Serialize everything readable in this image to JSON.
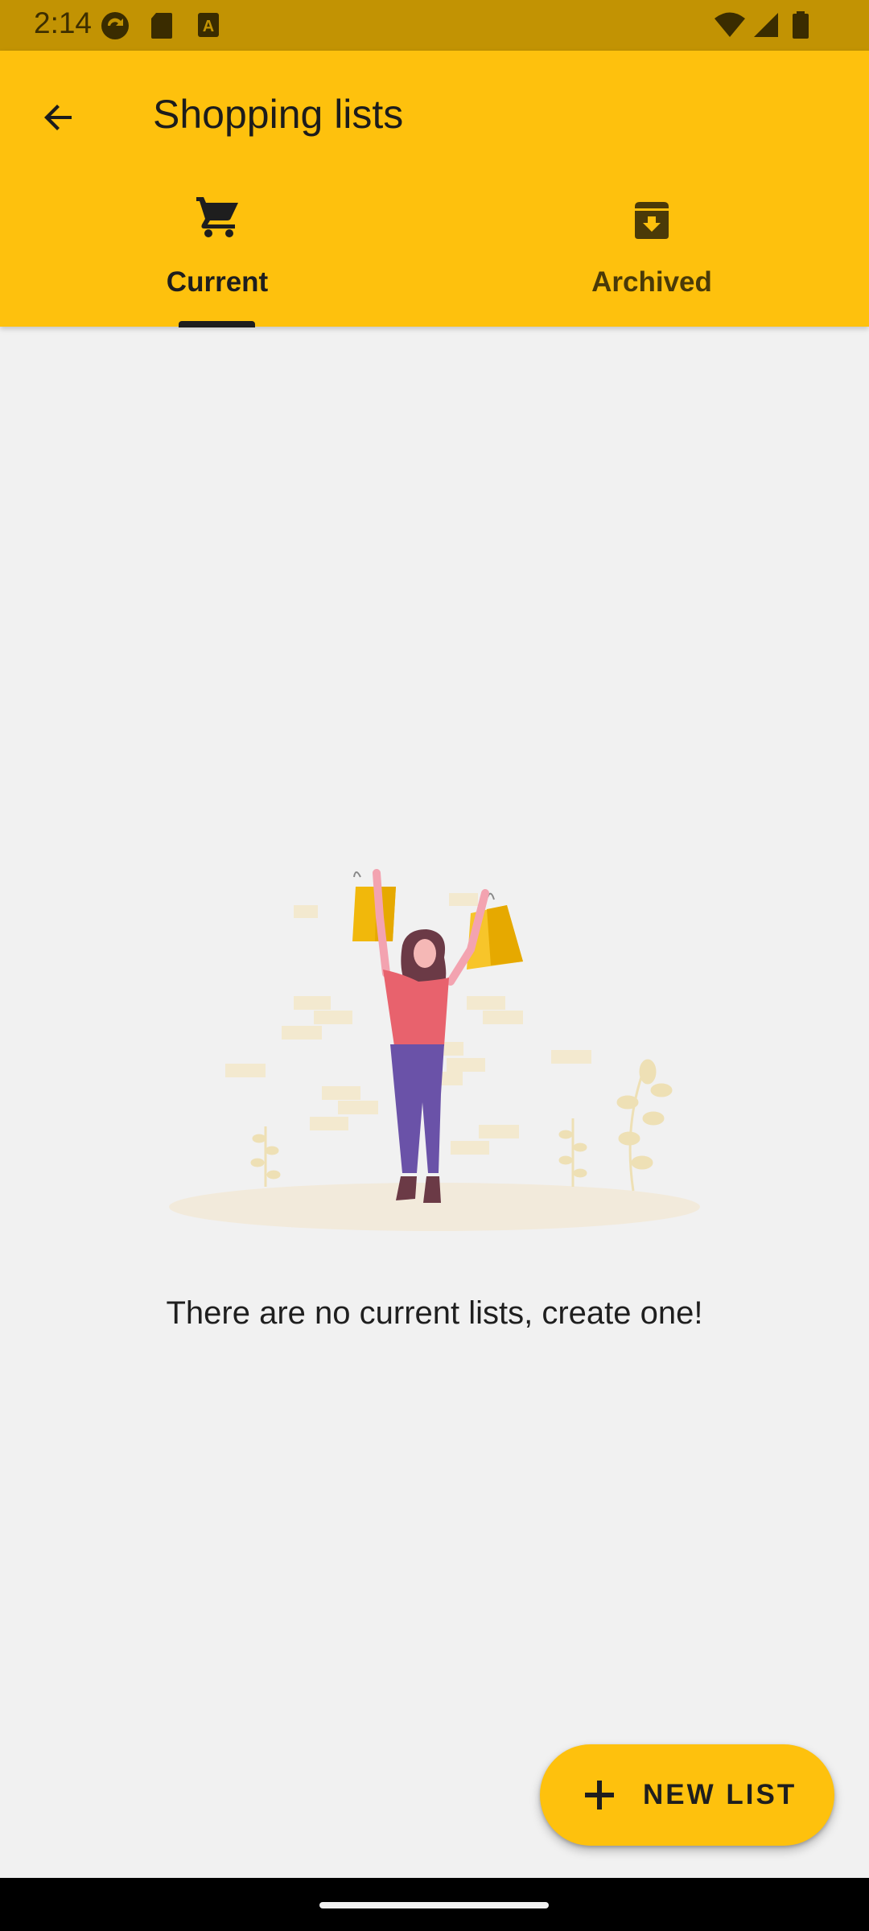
{
  "status_bar": {
    "time": "2:14",
    "icons": [
      "sync-notification-icon",
      "sd-card-icon",
      "font-icon",
      "wifi-icon",
      "signal-icon",
      "battery-icon"
    ]
  },
  "app_bar": {
    "back_icon": "arrow-back-icon",
    "title": "Shopping lists"
  },
  "tabs": [
    {
      "label": "Current",
      "icon": "cart-icon",
      "selected": true
    },
    {
      "label": "Archived",
      "icon": "archive-icon",
      "selected": false
    }
  ],
  "empty_state": {
    "illustration": "woman-with-shopping-bags-illustration",
    "message": "There are no current lists, create one!"
  },
  "fab": {
    "icon": "plus-icon",
    "label": "NEW LIST"
  },
  "colors": {
    "accent": "#fec10d",
    "status_bar": "#c29303",
    "background": "#f1f1f1",
    "tab_selected": "#1e1e1e",
    "tab_unselected": "#4a3a08"
  }
}
